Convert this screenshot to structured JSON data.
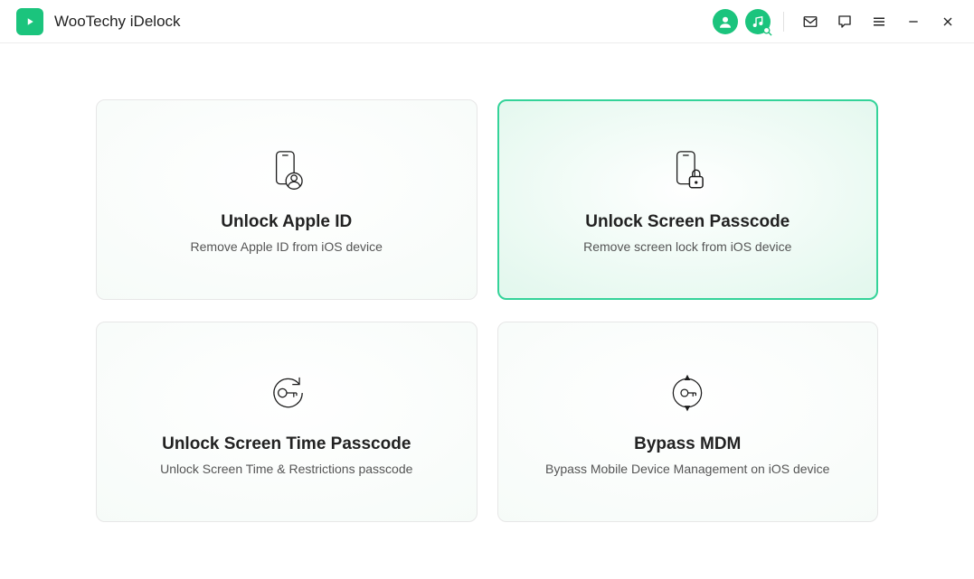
{
  "app": {
    "title": "WooTechy iDelock"
  },
  "cards": [
    {
      "title": "Unlock Apple ID",
      "desc": "Remove Apple ID from iOS device",
      "active": false
    },
    {
      "title": "Unlock Screen Passcode",
      "desc": "Remove screen lock from iOS device",
      "active": true
    },
    {
      "title": "Unlock Screen Time Passcode",
      "desc": "Unlock Screen Time & Restrictions passcode",
      "active": false
    },
    {
      "title": "Bypass MDM",
      "desc": "Bypass Mobile Device Management on iOS device",
      "active": false
    }
  ]
}
